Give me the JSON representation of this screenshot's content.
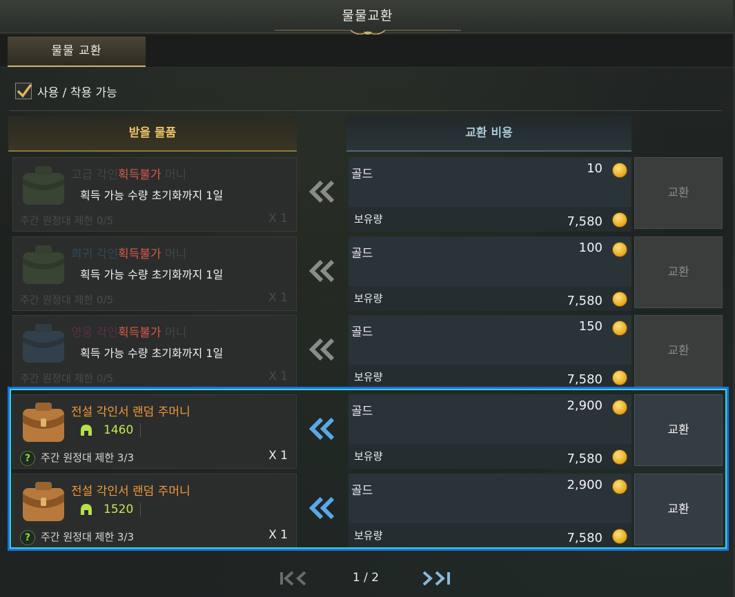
{
  "window": {
    "title": "물물교환"
  },
  "tabs": [
    {
      "label": "물물 교환",
      "active": true
    }
  ],
  "filter": {
    "label": "사용 / 착용 가능",
    "checked": true
  },
  "columns": {
    "receive": "받을 물품",
    "cost": "교환 비용"
  },
  "rows": [
    {
      "state": "disabled",
      "item_prefix": "고급 각인",
      "item_status": "획득불가",
      "item_suffix": "머니",
      "notice": "획득 가능 수량 초기화까지 1일",
      "limit": "주간 원정대 제한 0/5",
      "qty": "X 1",
      "cost_label": "골드",
      "cost_value": "10",
      "hold_label": "보유량",
      "hold_value": "7,580",
      "button": "교환"
    },
    {
      "state": "disabled",
      "item_prefix": "희귀 각인",
      "item_status": "획득불가",
      "item_suffix": "머니",
      "notice": "획득 가능 수량 초기화까지 1일",
      "limit": "주간 원정대 제한 0/5",
      "qty": "X 1",
      "cost_label": "골드",
      "cost_value": "100",
      "hold_label": "보유량",
      "hold_value": "7,580",
      "button": "교환"
    },
    {
      "state": "disabled",
      "item_prefix": "영웅 각인",
      "item_status": "획득불가",
      "item_suffix": "머니",
      "notice": "획득 가능 수량 초기화까지 1일",
      "limit": "주간 원정대 제한 0/5",
      "qty": "X 1",
      "cost_label": "골드",
      "cost_value": "150",
      "hold_label": "보유량",
      "hold_value": "7,580",
      "button": "교환"
    },
    {
      "state": "enabled",
      "item_name": "전설 각인서 랜덤 주머니",
      "count": "1460",
      "limit_help": "?",
      "limit": "주간 원정대 제한 3/3",
      "qty": "X 1",
      "cost_label": "골드",
      "cost_value": "2,900",
      "hold_label": "보유량",
      "hold_value": "7,580",
      "button": "교환"
    },
    {
      "state": "enabled",
      "item_name": "전설 각인서 랜덤 주머니",
      "count": "1520",
      "limit_help": "?",
      "limit": "주간 원정대 제한 3/3",
      "qty": "X 1",
      "cost_label": "골드",
      "cost_value": "2,900",
      "hold_label": "보유량",
      "hold_value": "7,580",
      "button": "교환"
    }
  ],
  "pager": {
    "text": "1 / 2"
  },
  "colors": {
    "accent_gold": "#d7b36a",
    "legend_orange": "#f29a3a",
    "highlight_blue": "#1f6fe0"
  },
  "icons": [
    "bag-icon",
    "coin-icon",
    "helmet-icon",
    "double-chevron-left-icon",
    "first-page-icon",
    "last-page-icon",
    "check-icon"
  ]
}
